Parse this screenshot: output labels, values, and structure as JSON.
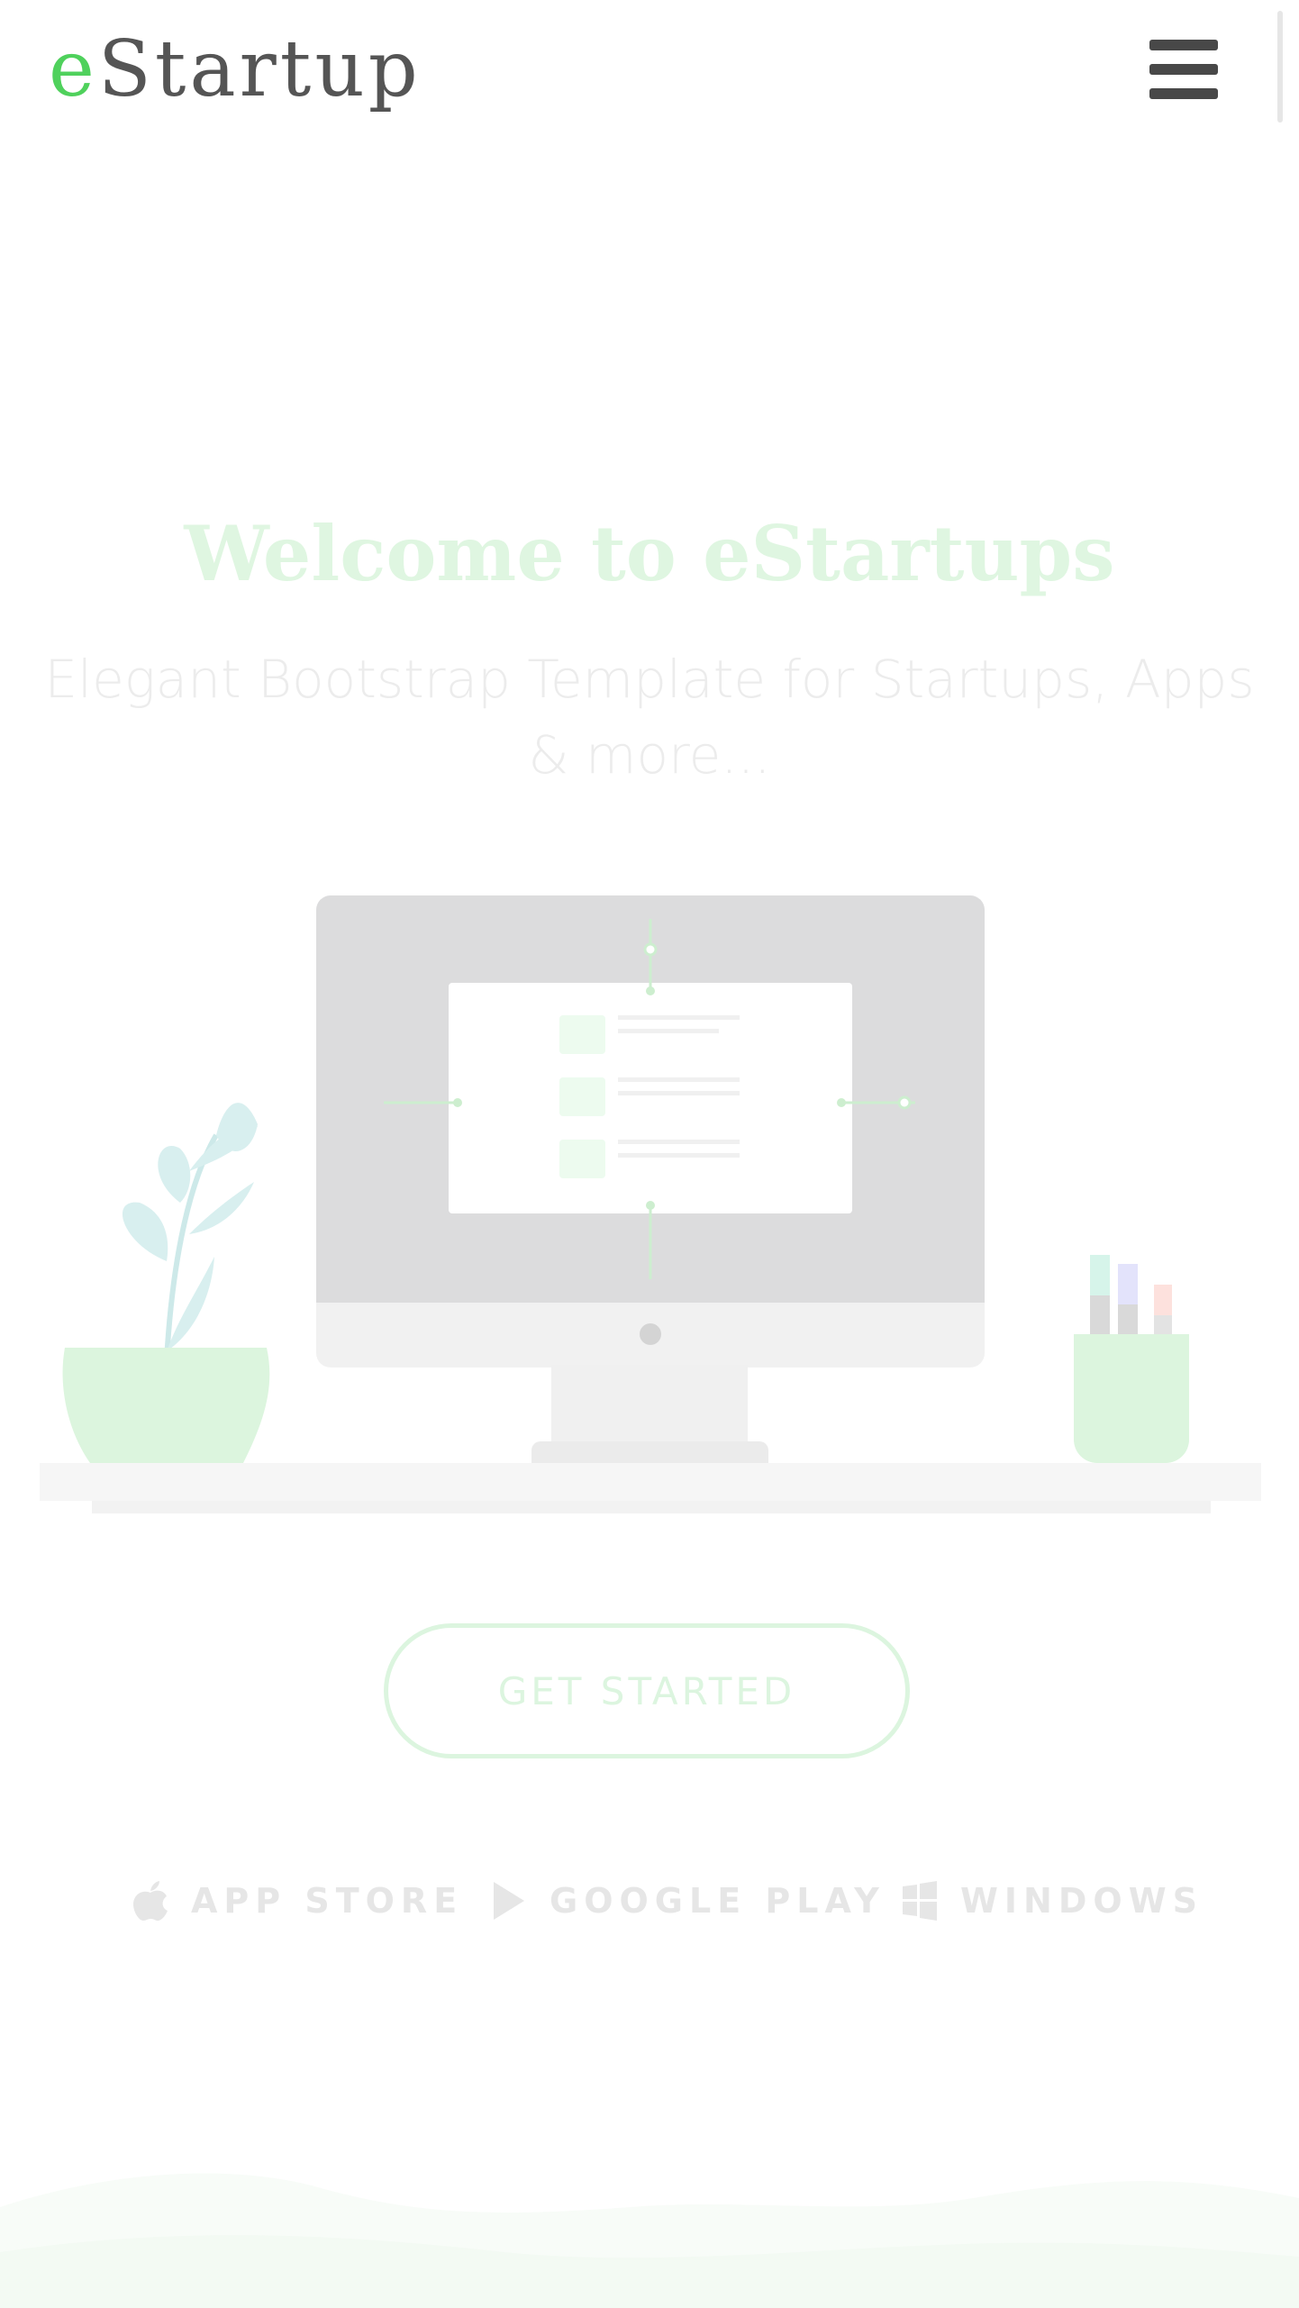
{
  "header": {
    "logo_accent": "e",
    "logo_rest": "Startup",
    "menu_icon": "hamburger-menu-icon"
  },
  "hero": {
    "title": "Welcome to eStartups",
    "subtitle": "Elegant Bootstrap Template for Startups, Apps & more...",
    "cta_label": "GET STARTED"
  },
  "stores": [
    {
      "label": "APP STORE",
      "icon": "apple-icon"
    },
    {
      "label": "GOOGLE PLAY",
      "icon": "play-icon"
    },
    {
      "label": "WINDOWS",
      "icon": "windows-icon"
    }
  ],
  "colors": {
    "brand_green": "#4fd15c",
    "logo_gray": "#555555",
    "title_tint": "#dff6e1",
    "subtitle_tint": "#ececec",
    "store_text": "#e6e6e6"
  }
}
